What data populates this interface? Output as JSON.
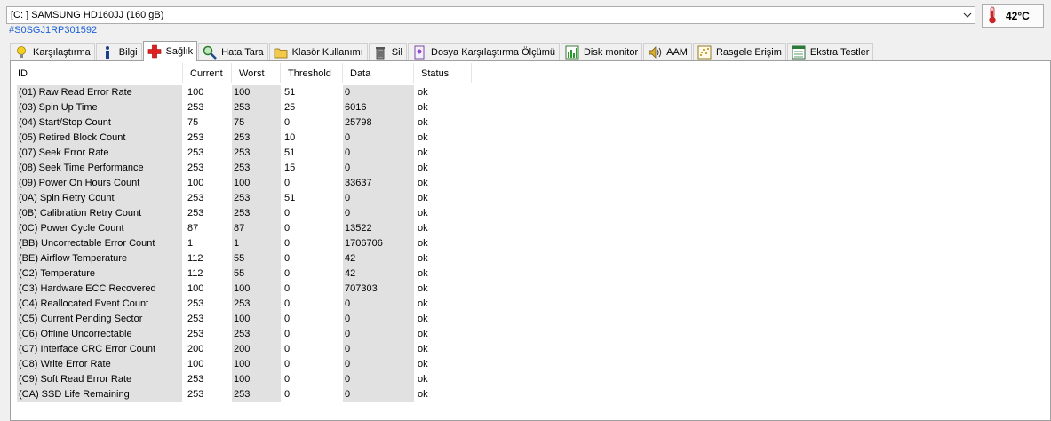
{
  "drive": {
    "selected": "[C: ] SAMSUNG HD160JJ (160 gB)",
    "serial": "#S0SGJ1RP301592",
    "temperature": "42°C"
  },
  "tabs": [
    {
      "label": "Karşılaştırma",
      "icon": "lightbulb-icon"
    },
    {
      "label": "Bilgi",
      "icon": "info-icon"
    },
    {
      "label": "Sağlık",
      "icon": "red-cross-icon"
    },
    {
      "label": "Hata Tara",
      "icon": "magnifier-icon"
    },
    {
      "label": "Klasör Kullanımı",
      "icon": "folder-icon"
    },
    {
      "label": "Sil",
      "icon": "trash-icon"
    },
    {
      "label": "Dosya Karşılaştırma Ölçümü",
      "icon": "file-benchmark-icon"
    },
    {
      "label": "Disk monitor",
      "icon": "monitor-chart-icon"
    },
    {
      "label": "AAM",
      "icon": "speaker-icon"
    },
    {
      "label": "Rasgele Erişim",
      "icon": "random-access-icon"
    },
    {
      "label": "Ekstra Testler",
      "icon": "extra-tests-icon"
    }
  ],
  "active_tab": "Sağlık",
  "columns": [
    "ID",
    "Current",
    "Worst",
    "Threshold",
    "Data",
    "Status"
  ],
  "rows": [
    [
      "(01) Raw Read Error Rate",
      "100",
      "100",
      "51",
      "0",
      "ok"
    ],
    [
      "(03) Spin Up Time",
      "253",
      "253",
      "25",
      "6016",
      "ok"
    ],
    [
      "(04) Start/Stop Count",
      "75",
      "75",
      "0",
      "25798",
      "ok"
    ],
    [
      "(05) Retired Block Count",
      "253",
      "253",
      "10",
      "0",
      "ok"
    ],
    [
      "(07) Seek Error Rate",
      "253",
      "253",
      "51",
      "0",
      "ok"
    ],
    [
      "(08) Seek Time Performance",
      "253",
      "253",
      "15",
      "0",
      "ok"
    ],
    [
      "(09) Power On Hours Count",
      "100",
      "100",
      "0",
      "33637",
      "ok"
    ],
    [
      "(0A) Spin Retry Count",
      "253",
      "253",
      "51",
      "0",
      "ok"
    ],
    [
      "(0B) Calibration Retry Count",
      "253",
      "253",
      "0",
      "0",
      "ok"
    ],
    [
      "(0C) Power Cycle Count",
      "87",
      "87",
      "0",
      "13522",
      "ok"
    ],
    [
      "(BB) Uncorrectable Error Count",
      "1",
      "1",
      "0",
      "1706706",
      "ok"
    ],
    [
      "(BE) Airflow Temperature",
      "112",
      "55",
      "0",
      "42",
      "ok"
    ],
    [
      "(C2) Temperature",
      "112",
      "55",
      "0",
      "42",
      "ok"
    ],
    [
      "(C3) Hardware ECC Recovered",
      "100",
      "100",
      "0",
      "707303",
      "ok"
    ],
    [
      "(C4) Reallocated Event Count",
      "253",
      "253",
      "0",
      "0",
      "ok"
    ],
    [
      "(C5) Current Pending Sector",
      "253",
      "100",
      "0",
      "0",
      "ok"
    ],
    [
      "(C6) Offline Uncorrectable",
      "253",
      "253",
      "0",
      "0",
      "ok"
    ],
    [
      "(C7) Interface CRC Error Count",
      "200",
      "200",
      "0",
      "0",
      "ok"
    ],
    [
      "(C8) Write Error Rate",
      "100",
      "100",
      "0",
      "0",
      "ok"
    ],
    [
      "(C9) Soft Read Error Rate",
      "253",
      "100",
      "0",
      "0",
      "ok"
    ],
    [
      "(CA) SSD Life Remaining",
      "253",
      "253",
      "0",
      "0",
      "ok"
    ]
  ],
  "colors": {
    "serial": "#1a5fd6",
    "shaded_column": "#e1e1e1",
    "health_cross": "#e02020"
  }
}
